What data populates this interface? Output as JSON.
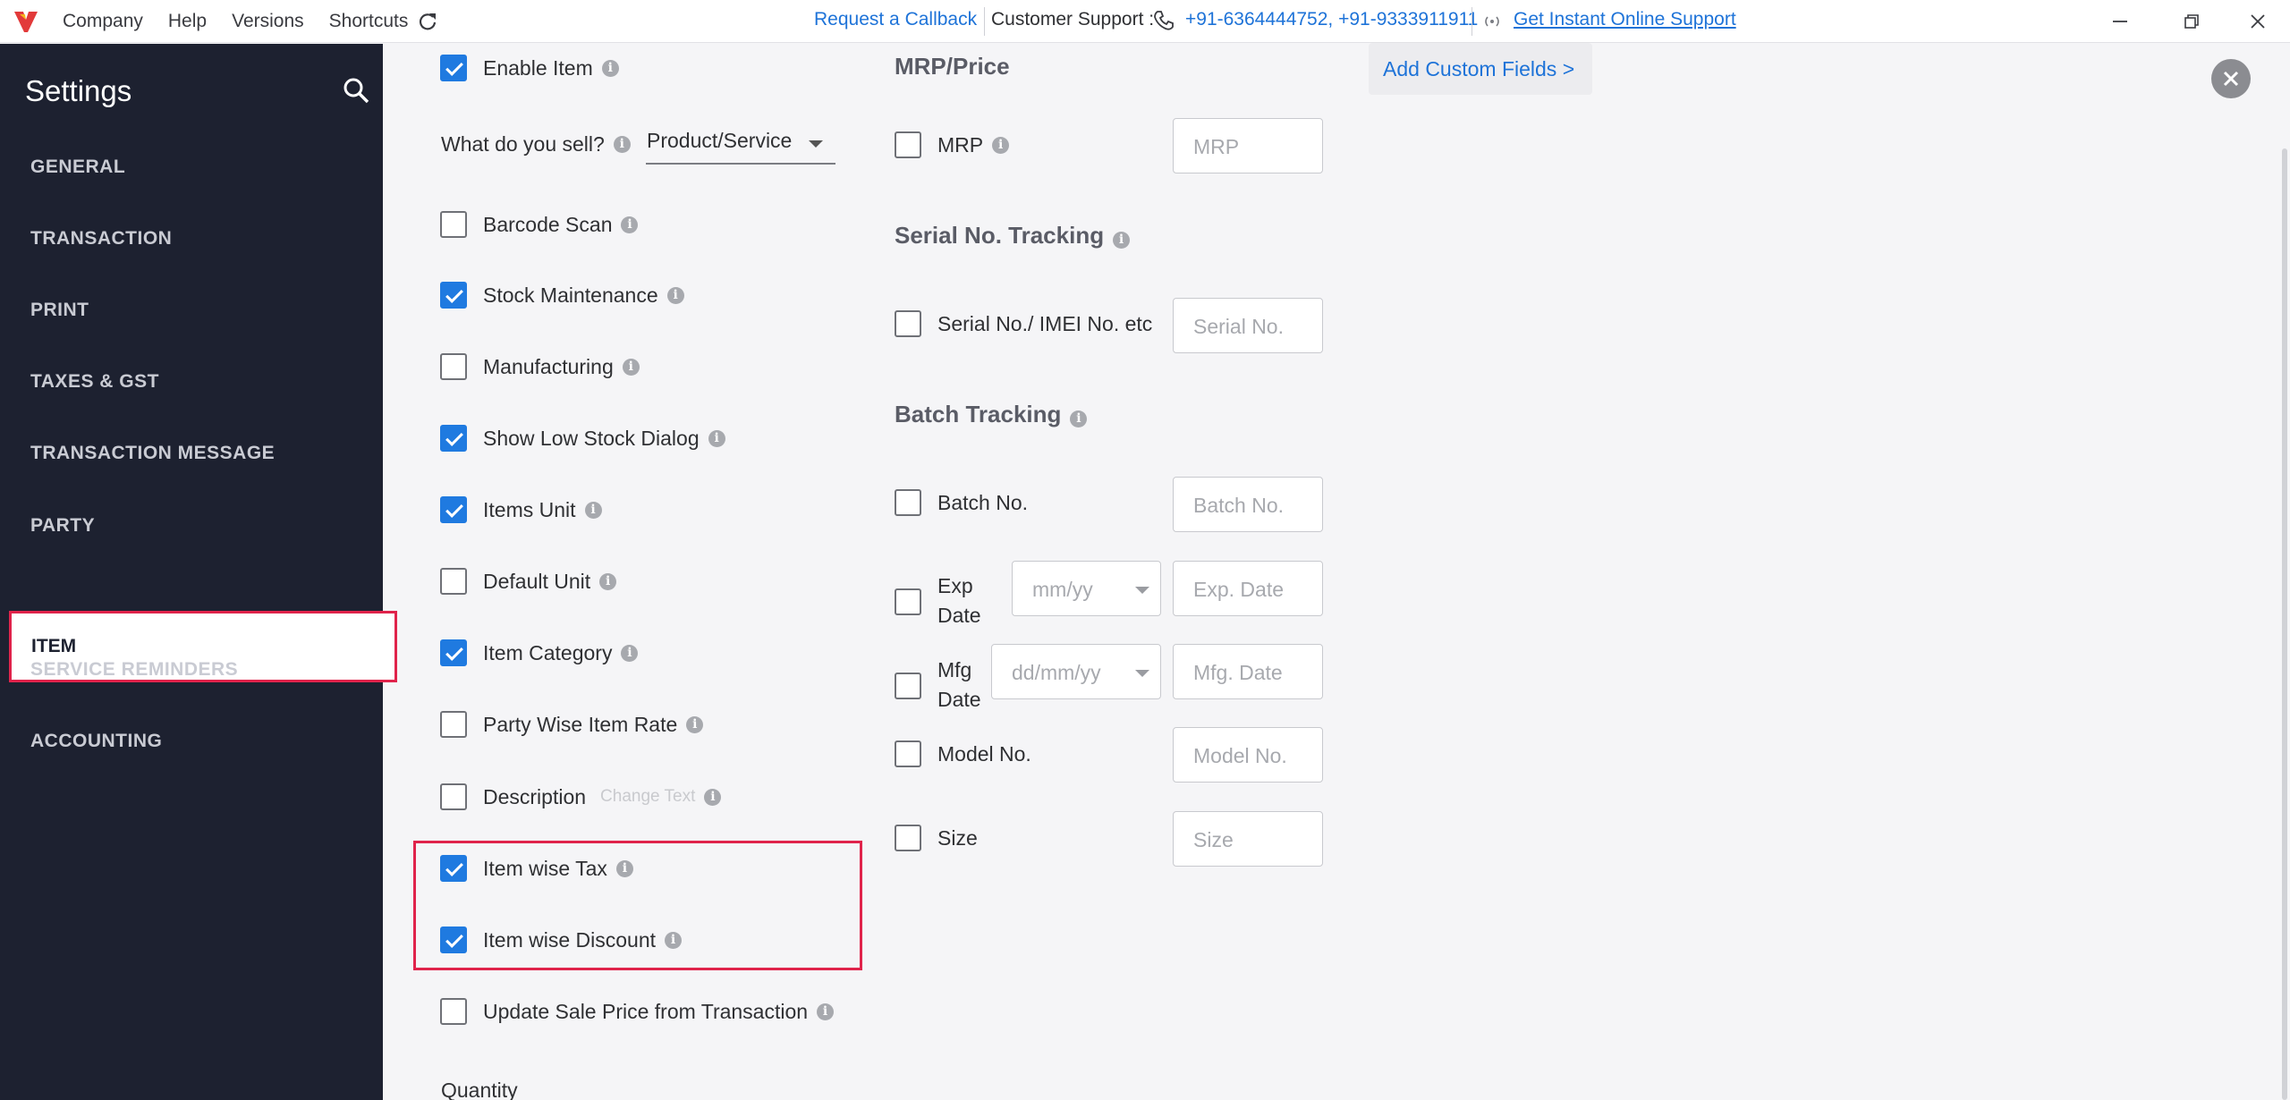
{
  "topbar": {
    "menu": [
      "Company",
      "Help",
      "Versions",
      "Shortcuts"
    ],
    "request_callback": "Request a Callback",
    "support_label": "Customer Support :",
    "phones": "+91-6364444752, +91-9333911911",
    "instant_support": "Get Instant Online Support"
  },
  "sidebar": {
    "title": "Settings",
    "items": [
      "GENERAL",
      "TRANSACTION",
      "PRINT",
      "TAXES & GST",
      "TRANSACTION MESSAGE",
      "PARTY",
      "ITEM",
      "SERVICE REMINDERS",
      "ACCOUNTING"
    ],
    "active": "ITEM"
  },
  "settings": {
    "enable_item": "Enable Item",
    "what_sell_label": "What do you sell?",
    "what_sell_value": "Product/Service",
    "barcode_scan": "Barcode Scan",
    "stock_maintenance": "Stock Maintenance",
    "manufacturing": "Manufacturing",
    "show_low_stock": "Show Low Stock Dialog",
    "items_unit": "Items Unit",
    "default_unit": "Default Unit",
    "item_category": "Item Category",
    "party_wise_rate": "Party Wise Item Rate",
    "description": "Description",
    "change_text": "Change Text",
    "item_wise_tax": "Item wise Tax",
    "item_wise_discount": "Item wise Discount",
    "update_sale_price": "Update Sale Price from Transaction",
    "quantity": "Quantity"
  },
  "checked": {
    "enable_item": true,
    "barcode_scan": false,
    "stock_maintenance": true,
    "manufacturing": false,
    "show_low_stock": true,
    "items_unit": true,
    "default_unit": false,
    "item_category": true,
    "party_wise_rate": false,
    "description": false,
    "item_wise_tax": true,
    "item_wise_discount": true,
    "update_sale_price": false
  },
  "tracking": {
    "mrp_title": "MRP/Price",
    "mrp_label": "MRP",
    "mrp_placeholder": "MRP",
    "serial_title": "Serial No. Tracking",
    "serial_label": "Serial No./ IMEI No. etc",
    "serial_placeholder": "Serial No.",
    "batch_title": "Batch Tracking",
    "batch_label": "Batch No.",
    "batch_placeholder": "Batch No.",
    "exp_label_1": "Exp",
    "exp_label_2": "Date",
    "exp_format": "mm/yy",
    "exp_placeholder": "Exp. Date",
    "mfg_label_1": "Mfg",
    "mfg_label_2": "Date",
    "mfg_format": "dd/mm/yy",
    "mfg_placeholder": "Mfg. Date",
    "model_label": "Model No.",
    "model_placeholder": "Model No.",
    "size_label": "Size",
    "size_placeholder": "Size"
  },
  "add_custom_fields": "Add Custom Fields >",
  "icons": {
    "logo": "vyapar-logo",
    "refresh": "refresh-icon",
    "phone": "phone-icon",
    "signal": "signal-icon",
    "search": "search-icon",
    "info": "info-icon",
    "close": "close-icon"
  },
  "colors": {
    "accent": "#1f7ae0",
    "link": "#1e73d8",
    "highlight": "#e0234b",
    "sidebar_bg": "#1d2130"
  }
}
